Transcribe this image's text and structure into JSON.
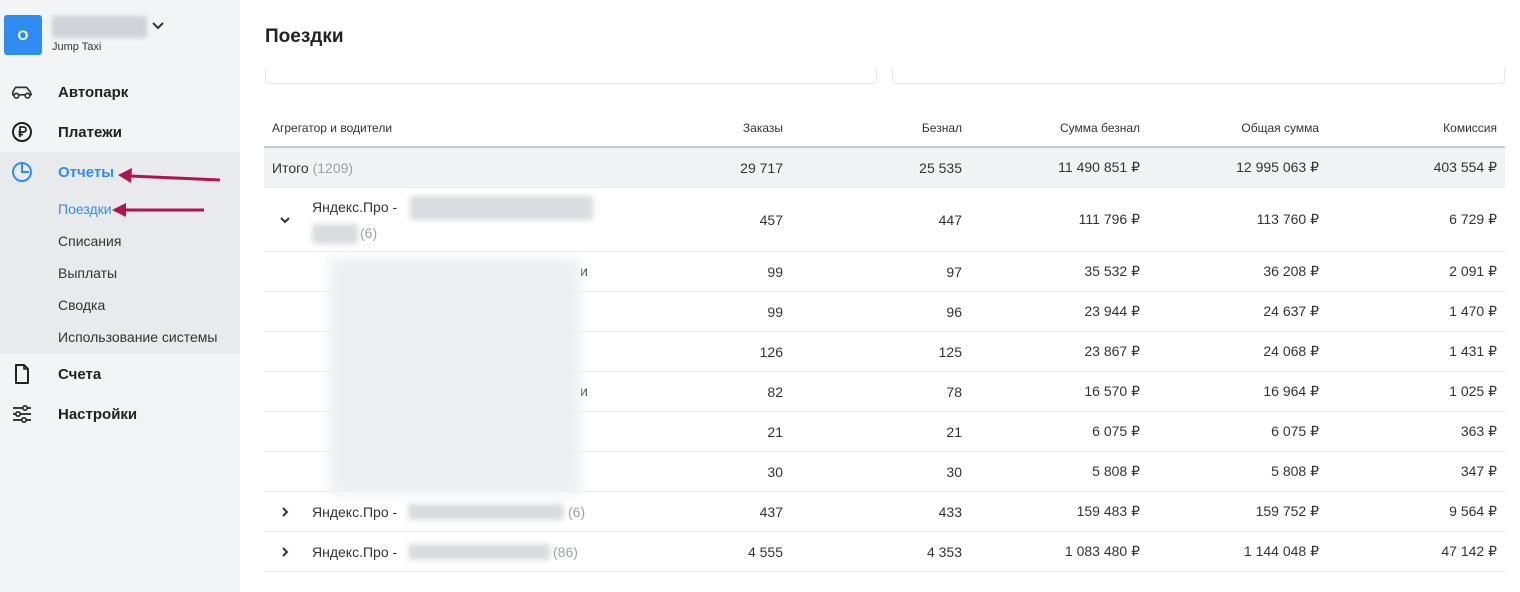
{
  "sidebar": {
    "org_initial": "O",
    "org_subtitle": "Jump Taxi",
    "nav": [
      {
        "label": "Автопарк",
        "icon": "car-icon"
      },
      {
        "label": "Платежи",
        "icon": "ruble-icon"
      },
      {
        "label": "Отчеты",
        "icon": "pie-chart-icon"
      },
      {
        "label": "Счета",
        "icon": "document-icon"
      },
      {
        "label": "Настройки",
        "icon": "sliders-icon"
      }
    ],
    "reports_sub": [
      "Поездки",
      "Списания",
      "Выплаты",
      "Сводка",
      "Использование системы"
    ]
  },
  "main": {
    "title": "Поездки",
    "columns": [
      "Агрегатор и водители",
      "Заказы",
      "Безнал",
      "Сумма безнал",
      "Общая сумма",
      "Комиссия"
    ],
    "total": {
      "label": "Итого",
      "count": "(1209)",
      "orders": "29 717",
      "cashless": "25 535",
      "sum_cashless": "11 490 851 ₽",
      "total": "12 995 063 ₽",
      "commission": "403 554 ₽"
    },
    "group1": {
      "label": "Яндекс.Про -",
      "count": "(6)",
      "orders": "457",
      "cashless": "447",
      "sum_cashless": "111 796 ₽",
      "total": "113 760 ₽",
      "commission": "6 729 ₽"
    },
    "children": [
      {
        "tail": "и",
        "orders": "99",
        "cashless": "97",
        "sum_cashless": "35 532 ₽",
        "total": "36 208 ₽",
        "commission": "2 091 ₽"
      },
      {
        "tail": "",
        "orders": "99",
        "cashless": "96",
        "sum_cashless": "23 944 ₽",
        "total": "24 637 ₽",
        "commission": "1 470 ₽"
      },
      {
        "tail": "",
        "orders": "126",
        "cashless": "125",
        "sum_cashless": "23 867 ₽",
        "total": "24 068 ₽",
        "commission": "1 431 ₽"
      },
      {
        "tail": "и",
        "orders": "82",
        "cashless": "78",
        "sum_cashless": "16 570 ₽",
        "total": "16 964 ₽",
        "commission": "1 025 ₽"
      },
      {
        "tail": "",
        "orders": "21",
        "cashless": "21",
        "sum_cashless": "6 075 ₽",
        "total": "6 075 ₽",
        "commission": "363 ₽"
      },
      {
        "tail": "",
        "orders": "30",
        "cashless": "30",
        "sum_cashless": "5 808 ₽",
        "total": "5 808 ₽",
        "commission": "347 ₽"
      }
    ],
    "group2": {
      "label": "Яндекс.Про -",
      "count": "(6)",
      "orders": "437",
      "cashless": "433",
      "sum_cashless": "159 483 ₽",
      "total": "159 752 ₽",
      "commission": "9 564 ₽"
    },
    "group3": {
      "label": "Яндекс.Про -",
      "count": "(86)",
      "orders": "4 555",
      "cashless": "4 353",
      "sum_cashless": "1 083 480 ₽",
      "total": "1 144 048 ₽",
      "commission": "47 142 ₽"
    }
  },
  "colors": {
    "accent": "#2f8cf0",
    "annotation_arrow": "#b0144f"
  }
}
